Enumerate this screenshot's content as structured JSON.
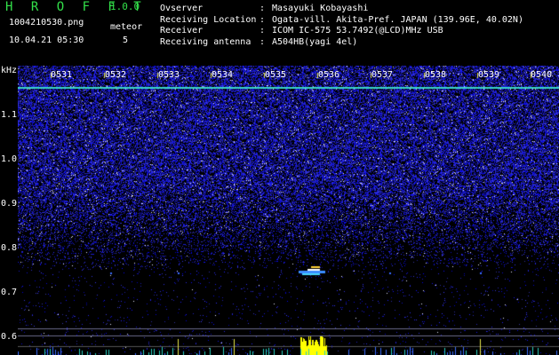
{
  "app": {
    "title": "H R O F F T",
    "version": "1.0.0"
  },
  "image": {
    "filename": "1004210530.png",
    "timestamp": "10.04.21 05:30"
  },
  "meteor": {
    "label": "meteor",
    "count": "5"
  },
  "info": [
    {
      "key": "Ovserver",
      "value": "Masayuki Kobayashi"
    },
    {
      "key": "Receiving Location",
      "value": "Ogata-vill. Akita-Pref. JAPAN (139.96E, 40.02N)"
    },
    {
      "key": "Receiver",
      "value": "ICOM IC-575 53.7492(@LCD)MHz USB"
    },
    {
      "key": "Receiving antenna",
      "value": "A504HB(yagi 4el)"
    }
  ],
  "axis": {
    "unit": "kHz",
    "ticks": [
      "1.1",
      "1.0",
      "0.9",
      "0.8",
      "0.7",
      "0.6"
    ],
    "times": [
      "0531",
      "0532",
      "0533",
      "0534",
      "0535",
      "0536",
      "0537",
      "0538",
      "0539",
      "0540"
    ]
  },
  "colors": {
    "title_green": "#33e04a",
    "tick_yellow": "#e8e84a",
    "line_cyan": "#3ad6c8",
    "noise_blue": "#2a2ad8"
  }
}
